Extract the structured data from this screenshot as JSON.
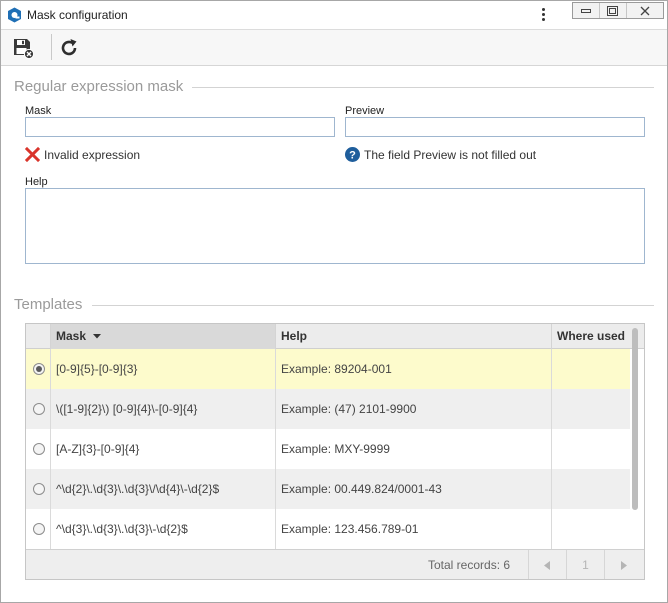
{
  "window": {
    "title": "Mask configuration"
  },
  "toolbar": {
    "save_icon": "save-close-icon",
    "refresh_icon": "refresh-icon"
  },
  "regex_section": {
    "title": "Regular expression mask",
    "mask_label": "Mask",
    "mask_value": "",
    "preview_label": "Preview",
    "preview_value": "",
    "validation_text": "Invalid expression",
    "preview_status_text": "The field Preview is not filled out",
    "help_label": "Help",
    "help_value": ""
  },
  "templates": {
    "title": "Templates",
    "columns": {
      "mask": "Mask",
      "help": "Help",
      "where_used": "Where used"
    },
    "rows": [
      {
        "mask": "[0-9]{5}-[0-9]{3}",
        "help": "Example: 89204-001",
        "where_used": "",
        "selected": true
      },
      {
        "mask": "\\([1-9]{2}\\) [0-9]{4}\\-[0-9]{4}",
        "help": "Example: (47) 2101-9900",
        "where_used": "",
        "selected": false
      },
      {
        "mask": "[A-Z]{3}-[0-9]{4}",
        "help": "Example: MXY-9999",
        "where_used": "",
        "selected": false
      },
      {
        "mask": "^\\d{2}\\.\\d{3}\\.\\d{3}\\/\\d{4}\\-\\d{2}$",
        "help": "Example: 00.449.824/0001-43",
        "where_used": "",
        "selected": false
      },
      {
        "mask": "^\\d{3}\\.\\d{3}\\.\\d{3}\\-\\d{2}$",
        "help": "Example: 123.456.789-01",
        "where_used": "",
        "selected": false
      }
    ],
    "footer": {
      "total_text": "Total records: 6",
      "current_page": "1"
    }
  },
  "colors": {
    "selected_row": "#fdfbcc",
    "striped_row": "#efefef",
    "error_red": "#d9342b",
    "info_blue": "#1f5e9c"
  }
}
